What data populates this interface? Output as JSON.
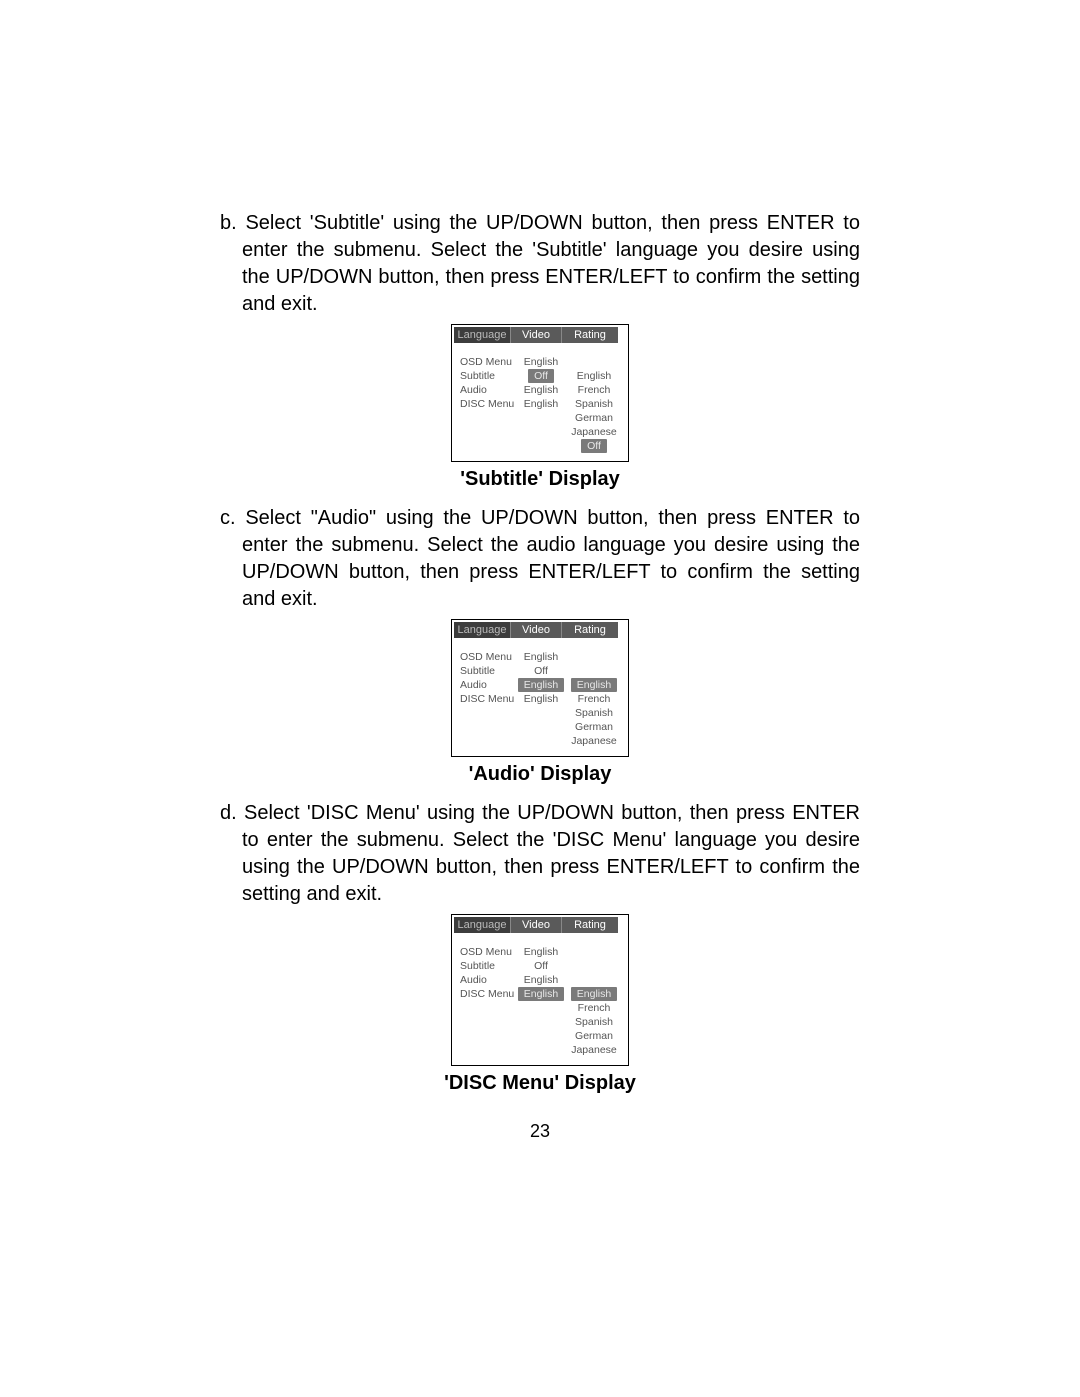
{
  "page_number": "23",
  "paragraphs": {
    "b": "b. Select 'Subtitle' using  the UP/DOWN button, then press  ENTER to enter the submenu. Select  the 'Subtitle' language you desire using the UP/DOWN button, then press ENTER/LEFT to confirm the setting and exit.",
    "c": "c. Select \"Audio\" using  the UP/DOWN button, then press  ENTER to enter the submenu. Select  the audio language you desire using the UP/DOWN button, then press ENTER/LEFT to confirm the setting and exit.",
    "d": "d. Select 'DISC Menu' using the UP/DOWN button, then press  ENTER to enter the submenu. Select  the 'DISC Menu' language you desire using  the UP/DOWN button, then press ENTER/LEFT to confirm the setting and exit."
  },
  "captions": {
    "subtitle": "'Subtitle' Display",
    "audio": "'Audio' Display",
    "disc": "'DISC Menu' Display"
  },
  "osd_tabs": {
    "language": "Language",
    "video": "Video",
    "rating": "Rating"
  },
  "osd_labels": {
    "osd_menu": "OSD Menu",
    "subtitle": "Subtitle",
    "audio": "Audio",
    "disc_menu": "DISC Menu"
  },
  "subtitle_screen": {
    "values": {
      "osd_menu": "English",
      "subtitle": "Off",
      "audio": "English",
      "disc_menu": "English"
    },
    "options": [
      "English",
      "French",
      "Spanish",
      "German",
      "Japanese",
      "Off"
    ],
    "selected_value_row": "subtitle",
    "selected_option": "Off"
  },
  "audio_screen": {
    "values": {
      "osd_menu": "English",
      "subtitle": "Off",
      "audio": "English",
      "disc_menu": "English"
    },
    "options": [
      "English",
      "French",
      "Spanish",
      "German",
      "Japanese"
    ],
    "selected_value_row": "audio",
    "selected_option": "English"
  },
  "disc_screen": {
    "values": {
      "osd_menu": "English",
      "subtitle": "Off",
      "audio": "English",
      "disc_menu": "English"
    },
    "options": [
      "English",
      "French",
      "Spanish",
      "German",
      "Japanese"
    ],
    "selected_value_row": "disc_menu",
    "selected_option": "English"
  }
}
